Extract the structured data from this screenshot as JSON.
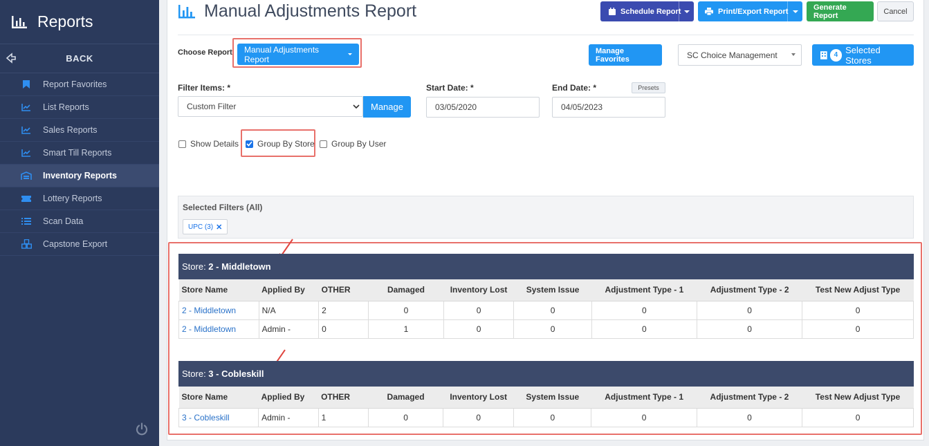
{
  "sidebar": {
    "title": "Reports",
    "back": "BACK",
    "items": [
      {
        "label": "Report Favorites",
        "icon": "bookmark-icon"
      },
      {
        "label": "List Reports",
        "icon": "line-chart-icon"
      },
      {
        "label": "Sales Reports",
        "icon": "line-chart-icon"
      },
      {
        "label": "Smart Till Reports",
        "icon": "line-chart-icon"
      },
      {
        "label": "Inventory Reports",
        "icon": "warehouse-icon"
      },
      {
        "label": "Lottery Reports",
        "icon": "ticket-icon"
      },
      {
        "label": "Scan Data",
        "icon": "list-icon"
      },
      {
        "label": "Capstone Export",
        "icon": "cubes-icon"
      }
    ],
    "active_item": "Inventory Reports"
  },
  "header": {
    "title": "Manual Adjustments Report",
    "schedule": "Schedule Report",
    "print": "Print/Export Report",
    "generate": "Generate Report",
    "cancel": "Cancel"
  },
  "controls": {
    "choose_report_label": "Choose Report",
    "report_dropdown": "Manual Adjustments Report",
    "manage_favorites": "Manage Favorites",
    "company_select": "SC Choice Management",
    "stores_count": "4",
    "stores_label": "Selected Stores",
    "filter_label": "Filter Items: *",
    "filter_value": "Custom Filter",
    "manage": "Manage",
    "start_label": "Start Date: *",
    "start_value": "03/05/2020",
    "end_label": "End Date: *",
    "end_value": "04/05/2023",
    "presets": "Presets",
    "show_details": "Show Details",
    "group_by_store": "Group By Store",
    "group_by_user": "Group By User"
  },
  "selected_filters": {
    "label": "Selected Filters (All)",
    "chip": "UPC (3)"
  },
  "columns": [
    "Store Name",
    "Applied By",
    "OTHER",
    "Damaged",
    "Inventory Lost",
    "System Issue",
    "Adjustment Type - 1",
    "Adjustment Type - 2",
    "Test New Adjust Type"
  ],
  "groups": [
    {
      "prefix": "Store: ",
      "name": "2 - Middletown",
      "rows": [
        [
          "2 - Middletown",
          "N/A",
          "2",
          "0",
          "0",
          "0",
          "0",
          "0",
          "0"
        ],
        [
          "2 - Middletown",
          "Admin -",
          "0",
          "1",
          "0",
          "0",
          "0",
          "0",
          "0"
        ]
      ]
    },
    {
      "prefix": "Store: ",
      "name": "3 - Cobleskill",
      "rows": [
        [
          "3 - Cobleskill",
          "Admin -",
          "1",
          "0",
          "0",
          "0",
          "0",
          "0",
          "0"
        ]
      ]
    }
  ],
  "colors": {
    "sidebar": "#2b3a5c",
    "accent_blue": "#2196f3",
    "highlight_red": "#e8706a",
    "store_header": "#3c4a6b"
  }
}
